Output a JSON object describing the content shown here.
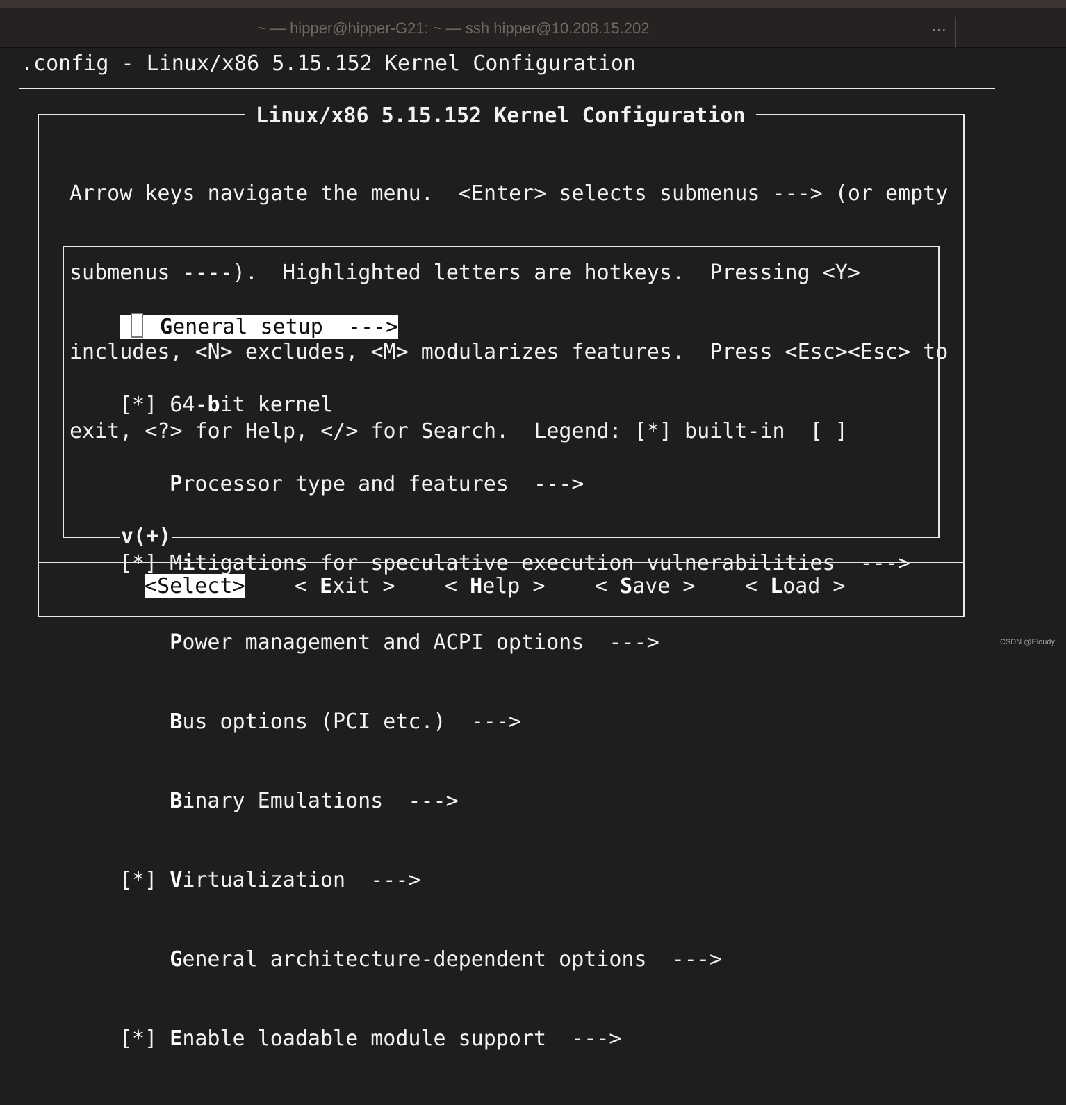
{
  "window": {
    "title": "~ — hipper@hipper-G21: ~ — ssh hipper@10.208.15.202",
    "more_icon": "…"
  },
  "terminal": {
    "config_title": ".config - Linux/x86 5.15.152 Kernel Configuration"
  },
  "dialog": {
    "title": "Linux/x86 5.15.152 Kernel Configuration",
    "help_lines": [
      "Arrow keys navigate the menu.  <Enter> selects submenus ---> (or empty",
      "submenus ----).  Highlighted letters are hotkeys.  Pressing <Y>",
      "includes, <N> excludes, <M> modularizes features.  Press <Esc><Esc> to",
      "exit, <?> for Help, </> for Search.  Legend: [*] built-in  [ ]"
    ]
  },
  "menu": {
    "items": [
      {
        "prefix": "",
        "hot": "G",
        "rest": "eneral setup  --->",
        "selected": true
      },
      {
        "prefix": "[*] ",
        "pre": "64-",
        "hot": "b",
        "rest": "it kernel",
        "selected": false
      },
      {
        "prefix": "    ",
        "hot": "P",
        "rest": "rocessor type and features  --->",
        "selected": false
      },
      {
        "prefix": "[*] ",
        "pre": "M",
        "hot": "i",
        "rest": "tigations for speculative execution vulnerabilities  --->",
        "selected": false
      },
      {
        "prefix": "    ",
        "hot": "P",
        "rest": "ower management and ACPI options  --->",
        "selected": false
      },
      {
        "prefix": "    ",
        "hot": "B",
        "rest": "us options (PCI etc.)  --->",
        "selected": false
      },
      {
        "prefix": "    ",
        "hot": "B",
        "rest": "inary Emulations  --->",
        "selected": false
      },
      {
        "prefix": "[*] ",
        "hot": "V",
        "rest": "irtualization  --->",
        "selected": false
      },
      {
        "prefix": "    ",
        "hot": "G",
        "rest": "eneral architecture-dependent options  --->",
        "selected": false
      },
      {
        "prefix": "[*] ",
        "hot": "E",
        "rest": "nable loadable module support  --->",
        "selected": false
      }
    ],
    "more_indicator": "v(+)"
  },
  "buttons": [
    {
      "open": "<",
      "hot": "",
      "label": "Select",
      "close": ">",
      "active": true
    },
    {
      "open": "< ",
      "hot": "E",
      "label": "xit",
      "close": " >",
      "active": false
    },
    {
      "open": "< ",
      "hot": "H",
      "label": "elp",
      "close": " >",
      "active": false
    },
    {
      "open": "< ",
      "hot": "S",
      "label": "ave",
      "close": " >",
      "active": false
    },
    {
      "open": "< ",
      "hot": "L",
      "label": "oad",
      "close": " >",
      "active": false
    }
  ],
  "watermark": "CSDN @Eloudy",
  "colors": {
    "background": "#1e1e1e",
    "titlebar": "#262221",
    "foreground": "#f2f2f2",
    "highlight": "#ffffff"
  }
}
